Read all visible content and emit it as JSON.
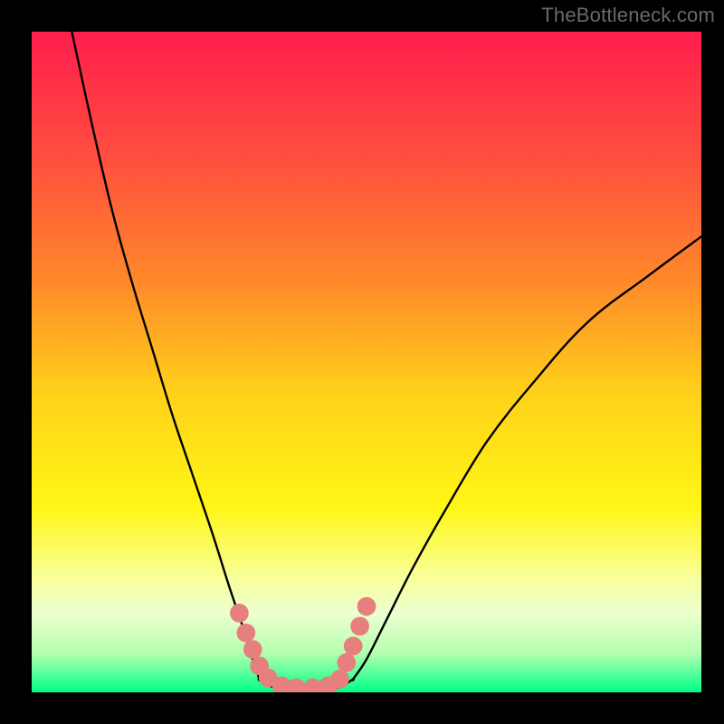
{
  "watermark": "TheBottleneck.com",
  "chart_data": {
    "type": "line",
    "title": "",
    "xlabel": "",
    "ylabel": "",
    "xlim": [
      0,
      100
    ],
    "ylim": [
      0,
      100
    ],
    "background": {
      "type": "vertical-gradient",
      "stops": [
        {
          "offset": 0.0,
          "color": "#ff1e4c"
        },
        {
          "offset": 0.18,
          "color": "#ff4b40"
        },
        {
          "offset": 0.38,
          "color": "#ff8a2a"
        },
        {
          "offset": 0.55,
          "color": "#ffd21a"
        },
        {
          "offset": 0.72,
          "color": "#fff615"
        },
        {
          "offset": 0.83,
          "color": "#f8ff9e"
        },
        {
          "offset": 0.88,
          "color": "#edffd0"
        },
        {
          "offset": 0.94,
          "color": "#b6ffb0"
        },
        {
          "offset": 1.0,
          "color": "#00ff87"
        }
      ]
    },
    "series": [
      {
        "name": "left-branch",
        "color": "#000000",
        "x": [
          6.0,
          9.0,
          12.0,
          15.0,
          18.0,
          21.0,
          24.0,
          27.0,
          29.5,
          31.5,
          33.0,
          34.0
        ],
        "y": [
          100.0,
          86.0,
          73.0,
          62.0,
          52.0,
          42.0,
          33.0,
          24.0,
          16.0,
          10.0,
          5.0,
          2.0
        ]
      },
      {
        "name": "floor",
        "color": "#000000",
        "x": [
          34.0,
          36.0,
          38.5,
          41.0,
          43.5,
          46.0,
          48.0
        ],
        "y": [
          2.0,
          0.8,
          0.3,
          0.3,
          0.4,
          0.8,
          2.0
        ]
      },
      {
        "name": "right-branch",
        "color": "#000000",
        "x": [
          48.0,
          50.0,
          53.0,
          57.0,
          62.0,
          68.0,
          75.0,
          83.0,
          92.0,
          100.0
        ],
        "y": [
          2.0,
          5.0,
          11.0,
          19.0,
          28.0,
          38.0,
          47.0,
          56.0,
          63.0,
          69.0
        ]
      }
    ],
    "markers": {
      "color": "#e77f7f",
      "radius_value_units": 1.4,
      "points": [
        {
          "x": 31.0,
          "y": 12.0
        },
        {
          "x": 32.0,
          "y": 9.0
        },
        {
          "x": 33.0,
          "y": 6.5
        },
        {
          "x": 34.0,
          "y": 4.0
        },
        {
          "x": 35.3,
          "y": 2.2
        },
        {
          "x": 37.3,
          "y": 1.0
        },
        {
          "x": 39.5,
          "y": 0.7
        },
        {
          "x": 42.0,
          "y": 0.7
        },
        {
          "x": 44.3,
          "y": 1.0
        },
        {
          "x": 46.0,
          "y": 2.0
        },
        {
          "x": 47.0,
          "y": 4.5
        },
        {
          "x": 48.0,
          "y": 7.0
        },
        {
          "x": 49.0,
          "y": 10.0
        },
        {
          "x": 50.0,
          "y": 13.0
        }
      ]
    }
  }
}
